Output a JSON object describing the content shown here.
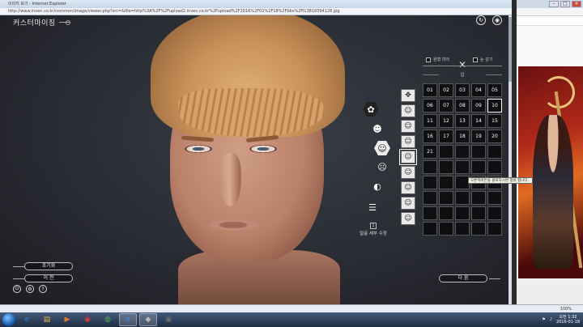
{
  "ie": {
    "title": "이미지 보기 - Internet Explorer",
    "address": "http://www.inven.co.kr/common/image/viewer.php?src=&file=http%3A%2F%2Fupload2.inven.co.kr%2Fupload%2F2016%2F01%2F18%2Fbbs%2Fi13819394128.jpg",
    "zoom": "100%"
  },
  "game": {
    "title": "커스터마이징",
    "buttons": {
      "reset": "초기화",
      "prev": "이 전",
      "next": "다 음"
    },
    "top_icons": [
      "refresh-icon",
      "eye-icon"
    ],
    "bottom_icons": [
      "power-icon",
      "settings-icon",
      "help-icon"
    ],
    "categories": [
      {
        "name": "overall-face-icon",
        "glyph": "✿"
      },
      {
        "name": "hairstyle-icon",
        "glyph": "☻"
      },
      {
        "name": "face-detail-icon",
        "glyph": "☺",
        "selected": true
      },
      {
        "name": "makeup-icon",
        "glyph": "☹"
      },
      {
        "name": "tattoo-icon",
        "glyph": "◐"
      },
      {
        "name": "detail-adjust-icon",
        "glyph": "☰"
      }
    ],
    "category_label": "얼굴 세부 수정",
    "category_label_num": "1",
    "parts": [
      {
        "name": "part-head-shape-icon",
        "glyph": "✥"
      },
      {
        "name": "part-forehead-icon",
        "glyph": "☺"
      },
      {
        "name": "part-brow-icon",
        "glyph": "☺"
      },
      {
        "name": "part-eyes-icon",
        "glyph": "☺"
      },
      {
        "name": "part-nose-icon",
        "glyph": "☺",
        "selected": true
      },
      {
        "name": "part-cheek-icon",
        "glyph": "☺"
      },
      {
        "name": "part-jaw-icon",
        "glyph": "☺"
      },
      {
        "name": "part-lips-icon",
        "glyph": "☺"
      },
      {
        "name": "part-chin-icon",
        "glyph": "☺"
      }
    ],
    "checkbox_left": "원형 미러",
    "checkbox_right": "눈 감기",
    "group_label": "입",
    "presets": [
      "01",
      "02",
      "03",
      "04",
      "05",
      "06",
      "07",
      "08",
      "09",
      "10",
      "11",
      "12",
      "13",
      "14",
      "15",
      "16",
      "17",
      "18",
      "19",
      "20",
      "21"
    ],
    "selected_preset": "10",
    "empty_cells": 29,
    "tooltip": "오른쪽버튼을 클릭하시면 정의 합니다."
  },
  "taskbar": {
    "apps": [
      {
        "name": "ie-taskbar-icon",
        "glyph": "e",
        "color": "#2b7bd6"
      },
      {
        "name": "explorer-taskbar-icon",
        "glyph": "▤",
        "color": "#e5b64a"
      },
      {
        "name": "media-taskbar-icon",
        "glyph": "▶",
        "color": "#e07b2a"
      },
      {
        "name": "app-taskbar-icon",
        "glyph": "◉",
        "color": "#e23a3a"
      },
      {
        "name": "chrome-taskbar-icon",
        "glyph": "◍",
        "color": "#4caf50"
      },
      {
        "name": "ie2-taskbar-icon",
        "glyph": "e",
        "color": "#3a8ee6",
        "active": true
      },
      {
        "name": "game-taskbar-icon",
        "glyph": "◆",
        "color": "#bbbbbb",
        "active": true
      },
      {
        "name": "app2-taskbar-icon",
        "glyph": "▣",
        "color": "#6a6a6a"
      }
    ],
    "time": "오전 1:32",
    "date": "2016-01-18"
  }
}
